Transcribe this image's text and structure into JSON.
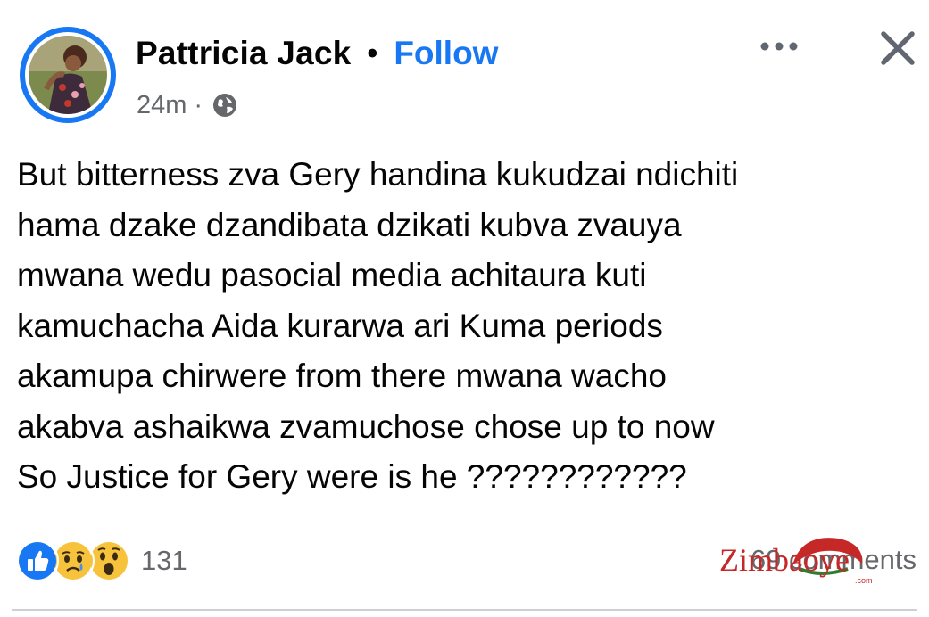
{
  "post": {
    "author": "Pattricia Jack",
    "separator": "•",
    "follow_label": "Follow",
    "time": "24m",
    "meta_dot": "·",
    "privacy_icon": "globe-icon",
    "text_lines": [
      "But bitterness zva Gery handina kukudzai ndichiti",
      "hama dzake dzandibata dzikati kubva zvauya",
      "mwana wedu pasocial media achitaura kuti",
      "kamuchacha Aida kurarwa ari Kuma periods",
      "akamupa chirwere from there mwana wacho",
      "akabva ashaikwa zvamuchose chose up to now",
      "So Justice for Gery were is he ????????????"
    ]
  },
  "header_icons": {
    "more": "more-horizontal-icon",
    "close": "close-icon"
  },
  "footer": {
    "reactions": [
      "like-icon",
      "sad-icon",
      "wow-icon"
    ],
    "reaction_count": "131",
    "comments": "69 comments"
  },
  "watermark": {
    "text": "Zimbaoye",
    "suffix": ".com"
  },
  "colors": {
    "accent": "#1877f2",
    "secondary_text": "#65676b",
    "text": "#050505"
  }
}
